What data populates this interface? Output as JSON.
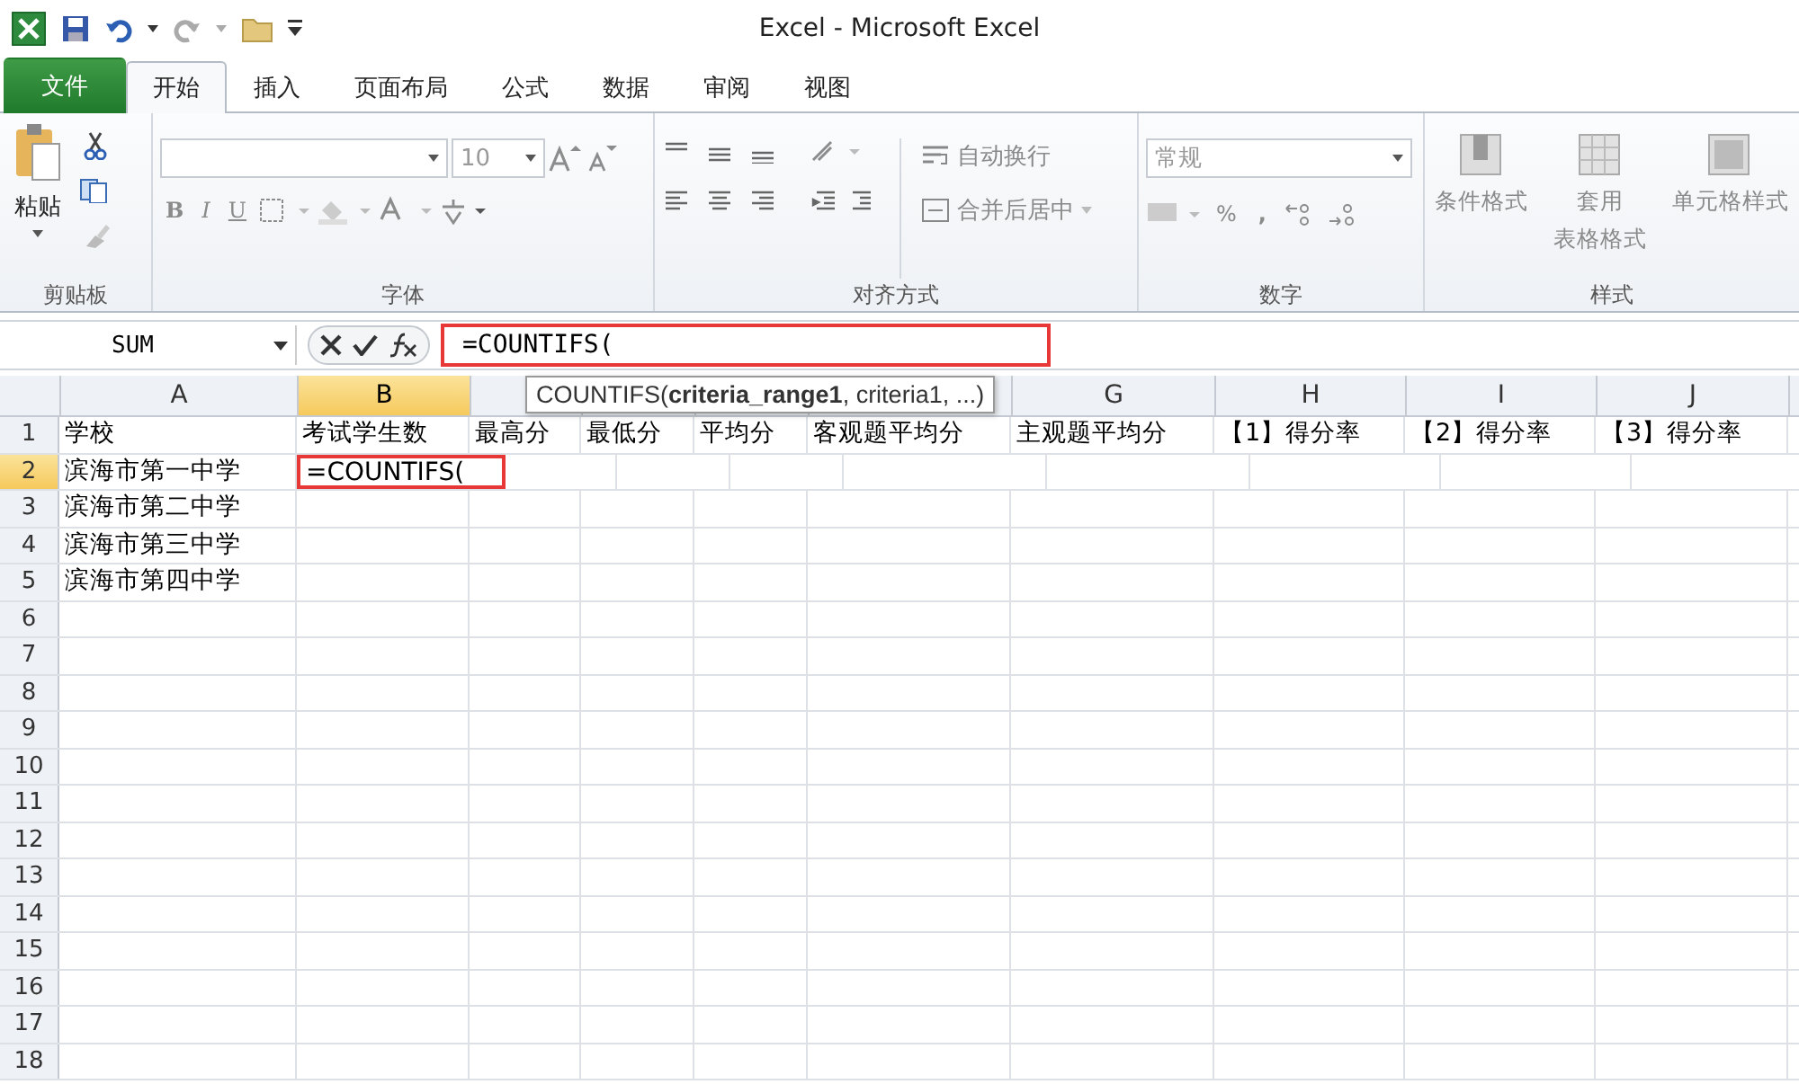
{
  "window": {
    "title": "Excel - Microsoft Excel"
  },
  "tabs": [
    {
      "label": "文件",
      "kind": "file",
      "selected": false
    },
    {
      "label": "开始",
      "kind": "tab",
      "selected": true
    },
    {
      "label": "插入",
      "kind": "tab",
      "selected": false
    },
    {
      "label": "页面布局",
      "kind": "tab",
      "selected": false
    },
    {
      "label": "公式",
      "kind": "tab",
      "selected": false
    },
    {
      "label": "数据",
      "kind": "tab",
      "selected": false
    },
    {
      "label": "审阅",
      "kind": "tab",
      "selected": false
    },
    {
      "label": "视图",
      "kind": "tab",
      "selected": false
    }
  ],
  "ribbon": {
    "clipboard": {
      "paste": "粘贴",
      "label": "剪贴板"
    },
    "font": {
      "size": "10",
      "bold": "B",
      "italic": "I",
      "underline": "U",
      "label": "字体"
    },
    "alignment": {
      "wrap": "自动换行",
      "merge": "合并后居中",
      "label": "对齐方式"
    },
    "number": {
      "format": "常规",
      "percent": "%",
      "comma": ",",
      "label": "数字"
    },
    "styles": {
      "conditional": "条件格式",
      "table_1": "套用",
      "table_2": "表格格式",
      "cell": "单元格样式",
      "label": "样式"
    }
  },
  "formula_bar": {
    "name_box": "SUM",
    "formula": "=COUNTIFS(",
    "highlighted": true,
    "tooltip": "COUNTIFS(**criteria_range1**, criteria1, ...)"
  },
  "columns_before_tooltip": [
    {
      "label": "A",
      "selected": false
    },
    {
      "label": "B",
      "selected": true
    },
    {
      "selected": false
    }
  ],
  "columns_after_tooltip": [
    {
      "label": "G",
      "selected": false
    },
    {
      "label": "H",
      "selected": false
    },
    {
      "label": "I",
      "selected": false
    },
    {
      "label": "J",
      "selected": false
    }
  ],
  "rows": [
    {
      "number": "1",
      "selected": false,
      "cells": [
        {
          "text": "学校"
        },
        {
          "text": "考试学生数"
        },
        {
          "text": "最高分"
        },
        {
          "text": "最低分"
        },
        {
          "text": "平均分"
        },
        {
          "text": "客观题平均分"
        },
        {
          "text": "主观题平均分"
        },
        {
          "text": "【1】得分率"
        },
        {
          "text": "【2】得分率"
        },
        {
          "text": "【3】得分率"
        }
      ]
    },
    {
      "number": "2",
      "selected": true,
      "cells": [
        {
          "text": "滨海市第一中学"
        },
        {
          "text": "=COUNTIFS(",
          "kind": "editing",
          "highlighted": true
        }
      ]
    },
    {
      "number": "3",
      "selected": false,
      "cells": [
        {
          "text": "滨海市第二中学"
        }
      ]
    },
    {
      "number": "4",
      "selected": false,
      "cells": [
        {
          "text": "滨海市第三中学"
        }
      ]
    },
    {
      "number": "5",
      "selected": false,
      "cells": [
        {
          "text": "滨海市第四中学"
        }
      ]
    },
    {
      "number": "6",
      "selected": false
    },
    {
      "number": "7",
      "selected": false
    },
    {
      "number": "8",
      "selected": false
    },
    {
      "number": "9",
      "selected": false
    },
    {
      "number": "10",
      "selected": false
    },
    {
      "number": "11",
      "selected": false
    },
    {
      "number": "12",
      "selected": false
    },
    {
      "number": "13",
      "selected": false
    },
    {
      "number": "14",
      "selected": false
    },
    {
      "number": "15",
      "selected": false
    },
    {
      "number": "16",
      "selected": false
    },
    {
      "number": "17",
      "selected": false
    },
    {
      "number": "18",
      "selected": false
    }
  ]
}
